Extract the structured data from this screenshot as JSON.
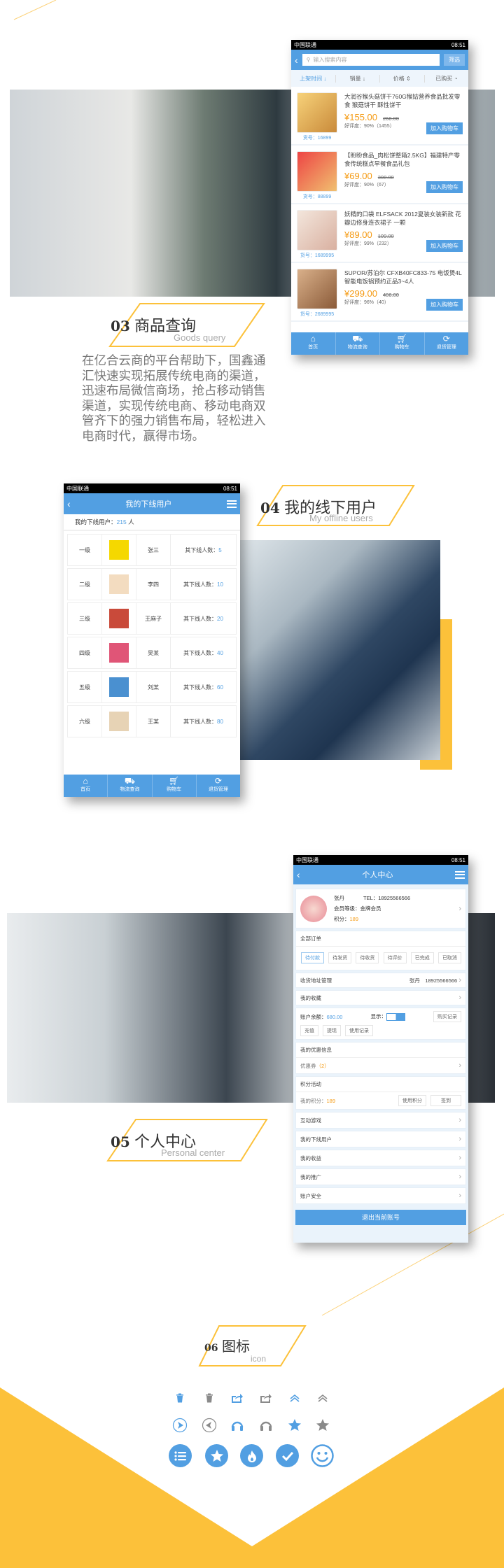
{
  "status_bar": {
    "carrier": "中国联通",
    "time": "08:51"
  },
  "s03": {
    "num": "03",
    "title": "商品查询",
    "subtitle": "Goods query",
    "paragraph": "在亿合云商的平台帮助下，国鑫通汇快速实现拓展传统电商的渠道，迅速布局微信商场，抢占移动销售渠道，实现传统电商、移动电商双管齐下的强力销售布局，轻松进入电商时代，赢得市场。"
  },
  "phone1": {
    "search_placeholder": "输入搜索内容",
    "filter_label": "筛选",
    "sorts": [
      "上架时间",
      "销量",
      "价格",
      "已购买"
    ],
    "cart_label": "加入购物车",
    "products": [
      {
        "title": "大润谷猴头菇饼干760G猴姑营养食品批发零食 猴菇饼干 酥性饼干",
        "price": "¥155.00",
        "old": "268.00",
        "rating": "好评度：90%（1455）",
        "sku": "货号：16899"
      },
      {
        "title": "【盼盼食品_肉松饼整箱2.5KG】福建特产零食传统糕点早餐食品礼包",
        "price": "¥69.00",
        "old": "308.00",
        "rating": "好评度：90%（67）",
        "sku": "货号：88899"
      },
      {
        "title": "妖精的口袋 ELFSACK 2012夏装女装新款 花瓣边修身连衣裙子 一颗",
        "price": "¥89.00",
        "old": "109.00",
        "rating": "好评度：99%（232）",
        "sku": "货号：1689995"
      },
      {
        "title": "SUPOR/苏泊尔 CFXB40FC833-75 电饭煲4L智能电饭锅预约正品3~4人",
        "price": "¥299.00",
        "old": "406.00",
        "rating": "好评度：96%（40）",
        "sku": "货号：2689995"
      }
    ]
  },
  "nav": [
    "首页",
    "物流查询",
    "购物车",
    "退货管理"
  ],
  "s04": {
    "num": "04",
    "title": "我的线下用户",
    "subtitle": "My offline users"
  },
  "phone2": {
    "header": "我的下线用户",
    "count_label": "我的下线用户：",
    "count": "215",
    "count_unit": "人",
    "rows": [
      {
        "level": "一级",
        "name": "张三",
        "label": "其下线人数：",
        "count": "5"
      },
      {
        "level": "二级",
        "name": "李四",
        "label": "其下线人数：",
        "count": "10"
      },
      {
        "level": "三级",
        "name": "王麻子",
        "label": "其下线人数：",
        "count": "20"
      },
      {
        "level": "四级",
        "name": "吴某",
        "label": "其下线人数：",
        "count": "40"
      },
      {
        "level": "五级",
        "name": "刘某",
        "label": "其下线人数：",
        "count": "60"
      },
      {
        "level": "六级",
        "name": "王某",
        "label": "其下线人数：",
        "count": "80"
      }
    ]
  },
  "s05": {
    "num": "05",
    "title": "个人中心",
    "subtitle": "Personal center"
  },
  "phone3": {
    "header": "个人中心",
    "name": "张丹",
    "tel": "TEL：18925566566",
    "level": "会员等级：金牌会员",
    "points_label": "积分：",
    "points": "189",
    "orders_title": "全部订单",
    "order_tabs": [
      "待付款",
      "待发货",
      "待收货",
      "待评价",
      "已完成",
      "已取消"
    ],
    "address_label": "收货地址管理",
    "address_value": "张丹　18925566566",
    "favorites": "我的收藏",
    "balance_label": "账户余额：",
    "balance": "680.00",
    "show_label": "显示：",
    "purchase_record": "购买记录",
    "account_buttons": [
      "充值",
      "提现",
      "使用记录"
    ],
    "coupon_title": "我的优惠信息",
    "coupon_label": "优惠券",
    "coupon_count": "（2）",
    "points_title": "积分活动",
    "my_points_label": "我的积分：",
    "my_points": "189",
    "use_points": "使用积分",
    "checkin": "签到",
    "menu": [
      "互动游戏",
      "我的下线用户",
      "我的收益",
      "我的推广",
      "账户安全"
    ],
    "logout": "退出当前账号"
  },
  "s06": {
    "num": "06",
    "title": "图标",
    "subtitle": "icon",
    "icons_row1": [
      "trash-icon",
      "trash-icon",
      "share-icon",
      "share-icon",
      "double-chevron-up-icon",
      "double-chevron-up-icon"
    ],
    "icons_row2": [
      "circle-arrow-right-icon",
      "circle-arrow-left-icon",
      "headphones-icon",
      "headphones-icon",
      "star-icon",
      "star-icon"
    ],
    "icons_row3": [
      "list-icon",
      "star-icon",
      "fire-icon",
      "check-icon",
      "smiley-icon"
    ]
  },
  "colors": {
    "accent": "#529fe2",
    "price": "#f59a12",
    "gold": "#fcc13a",
    "gray_icon": "#8a8a8a"
  }
}
